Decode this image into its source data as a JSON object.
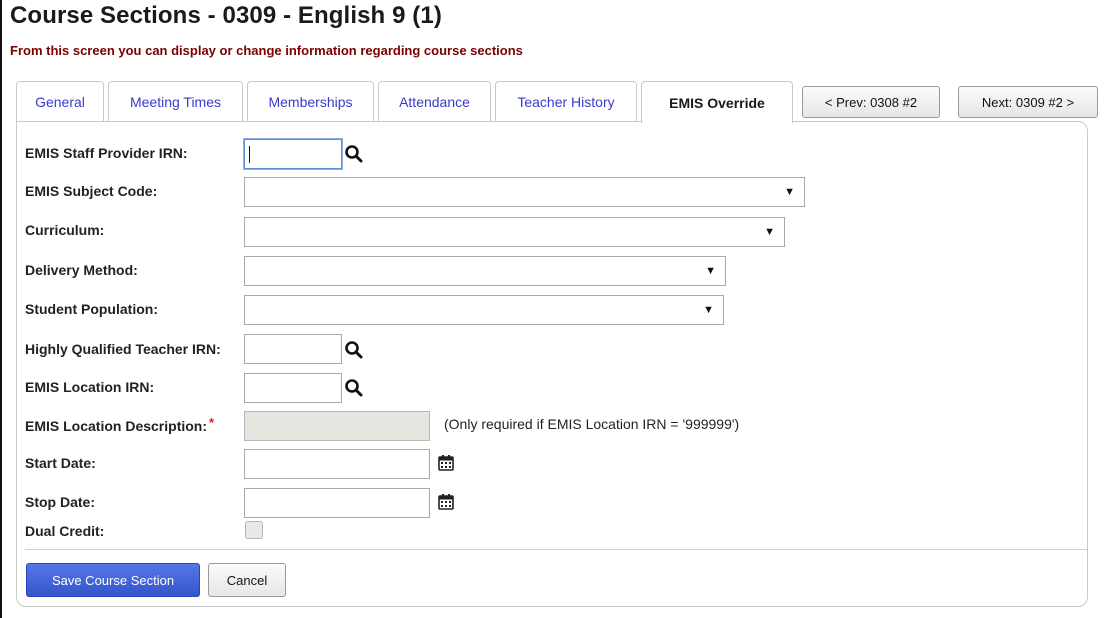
{
  "header": {
    "title": "Course Sections - 0309 - English 9 (1)",
    "subtitle": "From this screen you can display or change information regarding course sections"
  },
  "tabs": [
    {
      "label": "General"
    },
    {
      "label": "Meeting Times"
    },
    {
      "label": "Memberships"
    },
    {
      "label": "Attendance"
    },
    {
      "label": "Teacher History"
    },
    {
      "label": "EMIS Override",
      "active": true
    }
  ],
  "nav": {
    "prev_label": "< Prev: 0308 #2",
    "next_label": "Next: 0309 #2 >"
  },
  "form": {
    "staff_provider_irn": {
      "label": "EMIS Staff Provider IRN:",
      "value": ""
    },
    "subject_code": {
      "label": "EMIS Subject Code:",
      "selected": ""
    },
    "curriculum": {
      "label": "Curriculum:",
      "selected": ""
    },
    "delivery_method": {
      "label": "Delivery Method:",
      "selected": ""
    },
    "student_population": {
      "label": "Student Population:",
      "selected": ""
    },
    "hq_teacher_irn": {
      "label": "Highly Qualified Teacher IRN:",
      "value": ""
    },
    "location_irn": {
      "label": "EMIS Location IRN:",
      "value": ""
    },
    "location_description": {
      "label": "EMIS Location Description:",
      "required_mark": "*",
      "value": "",
      "note": "(Only required if EMIS Location IRN = '999999')"
    },
    "start_date": {
      "label": "Start Date:",
      "value": ""
    },
    "stop_date": {
      "label": "Stop Date:",
      "value": ""
    },
    "dual_credit": {
      "label": "Dual Credit:",
      "checked": false
    }
  },
  "actions": {
    "save_label": "Save Course Section",
    "cancel_label": "Cancel"
  },
  "icons": {
    "search": "search-icon",
    "calendar": "calendar-icon",
    "dropdown": "chevron-down-icon"
  },
  "colors": {
    "tab_link": "#3a3acc",
    "subtitle": "#7a0000",
    "primary_button": "#3f61d6",
    "required": "#d22222"
  }
}
